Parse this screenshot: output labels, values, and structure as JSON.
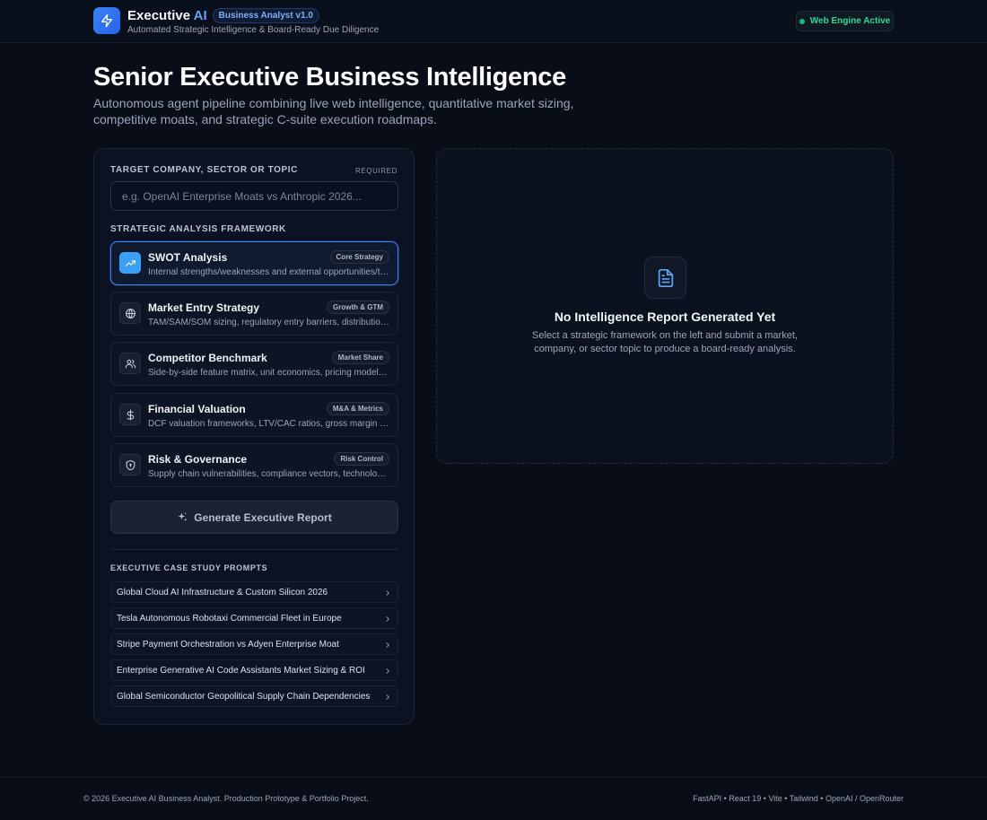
{
  "header": {
    "brand_name": "Executive",
    "brand_ai": "AI",
    "version_badge": "Business Analyst v1.0",
    "subtitle": "Automated Strategic Intelligence & Board-Ready Due Diligence",
    "status": "Web Engine Active",
    "status_color": "#10b981"
  },
  "hero": {
    "title": "Senior Executive Business Intelligence",
    "description": "Autonomous agent pipeline combining live web intelligence, quantitative market sizing, competitive moats, and strategic C-suite execution roadmaps."
  },
  "form": {
    "topic_label": "Target Company, Sector or Topic",
    "required_label": "Required",
    "topic_placeholder": "e.g. OpenAI Enterprise Moats vs Anthropic 2026...",
    "topic_value": "",
    "framework_label": "Strategic Analysis Framework",
    "frameworks": [
      {
        "title": "SWOT Analysis",
        "badge": "Core Strategy",
        "description": "Internal strengths/weaknesses and external opportunities/threats",
        "icon": "trending-up-icon",
        "selected": true
      },
      {
        "title": "Market Entry Strategy",
        "badge": "Growth & GTM",
        "description": "TAM/SAM/SOM sizing, regulatory entry barriers, distribution channels",
        "icon": "globe-icon",
        "selected": false
      },
      {
        "title": "Competitor Benchmark",
        "badge": "Market Share",
        "description": "Side-by-side feature matrix, unit economics, pricing models, and moats",
        "icon": "users-icon",
        "selected": false
      },
      {
        "title": "Financial Valuation",
        "badge": "M&A & Metrics",
        "description": "DCF valuation frameworks, LTV/CAC ratios, gross margin analysis",
        "icon": "dollar-icon",
        "selected": false
      },
      {
        "title": "Risk & Governance",
        "badge": "Risk Control",
        "description": "Supply chain vulnerabilities, compliance vectors, technological risk",
        "icon": "shield-icon",
        "selected": false
      }
    ],
    "generate_label": "Generate Executive Report",
    "prompts_label": "Executive Case Study Prompts",
    "prompts": [
      "Global Cloud AI Infrastructure & Custom Silicon 2026",
      "Tesla Autonomous Robotaxi Commercial Fleet in Europe",
      "Stripe Payment Orchestration vs Adyen Enterprise Moat",
      "Enterprise Generative AI Code Assistants Market Sizing & ROI",
      "Global Semiconductor Geopolitical Supply Chain Dependencies"
    ]
  },
  "report": {
    "empty_title": "No Intelligence Report Generated Yet",
    "empty_description": "Select a strategic framework on the left and submit a market, company, or sector topic to produce a board-ready analysis."
  },
  "footer": {
    "copyright": "© 2026 Executive AI Business Analyst. Production Prototype & Portfolio Project.",
    "stack": "FastAPI • React 19 • Vite • Tailwind • OpenAI / OpenRouter"
  },
  "colors": {
    "accent": "#3b82f6",
    "active_icon": "#3aa0f5",
    "background": "#080d18"
  }
}
